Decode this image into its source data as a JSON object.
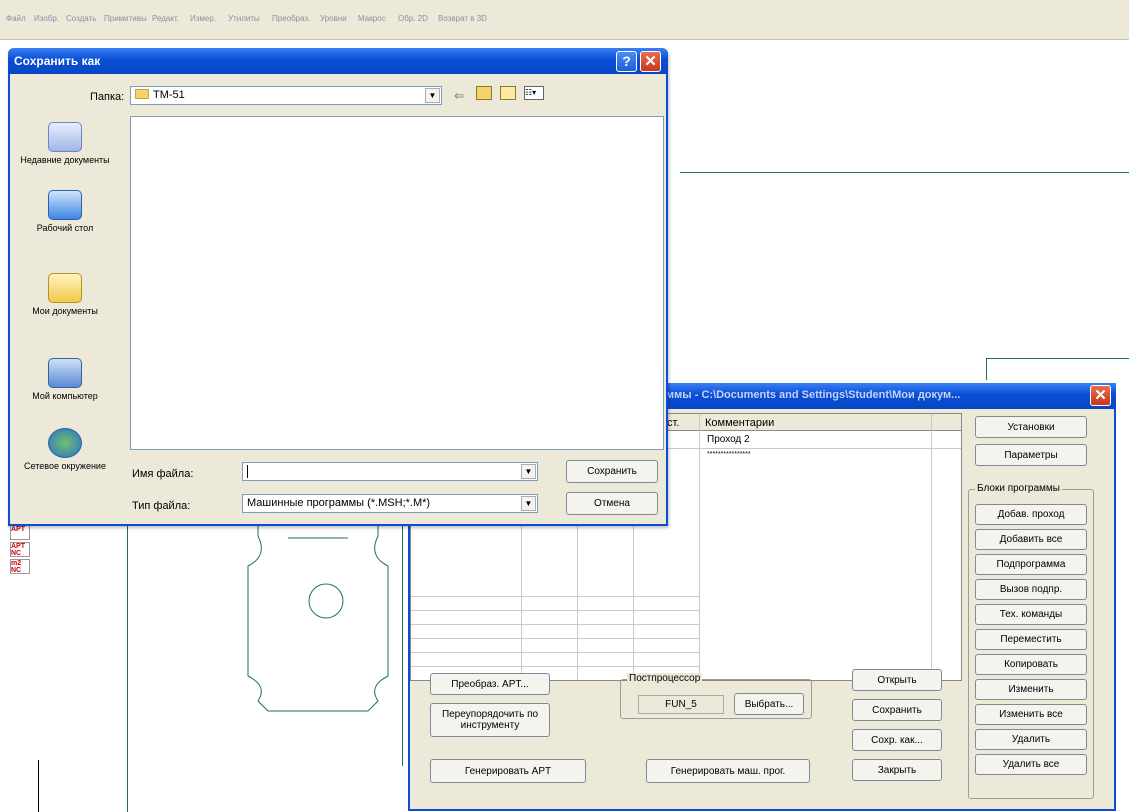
{
  "menubar": {
    "items": [
      "Файл",
      "Изобр.",
      "Создать",
      "Примитивы",
      "Редакт.",
      "Измер.",
      "Утилиты",
      "Преобраз.",
      "Уровни",
      "Макрос",
      "Обр. 2D",
      "Возврат в 3D"
    ]
  },
  "left_toolbar": {
    "items": [
      "APT",
      "APT NC",
      "m2 NC"
    ]
  },
  "save_dialog": {
    "title": "Сохранить как",
    "folder_label": "Папка:",
    "folder_value": "TM-51",
    "places": [
      "Недавние документы",
      "Рабочий стол",
      "Мои документы",
      "Мой компьютер",
      "Сетевое окружение"
    ],
    "filename_label": "Имя файла:",
    "filename_value": "",
    "filetype_label": "Тип файла:",
    "filetype_value": "Машинные программы (*.MSH;*.M*)",
    "save_button": "Сохранить",
    "cancel_button": "Отмена",
    "help_glyph": "?",
    "close_glyph": "✕"
  },
  "program_dialog": {
    "title": "ммы - C:\\Documents and Settings\\Student\\Мои докум...",
    "table": {
      "columns": [
        "ст.",
        "Комментарии"
      ],
      "rows": [
        [
          "",
          "Проход 2"
        ],
        [
          "",
          "****************"
        ]
      ]
    },
    "buttons": {
      "setup": "Установки",
      "params": "Параметры",
      "add_pass": "Добав. проход",
      "add_all": "Добавить все",
      "subprogram": "Подпрограмма",
      "call_sub": "Вызов подпр.",
      "tech_commands": "Тех. команды",
      "move": "Переместить",
      "copy": "Копировать",
      "change": "Изменить",
      "change_all": "Изменить все",
      "delete": "Удалить",
      "delete_all": "Удалить все",
      "convert_apt": "Преобраз. APT...",
      "reorder": "Переупорядочить по инструменту",
      "gen_apt": "Генерировать APT",
      "choose": "Выбрать...",
      "gen_machine": "Генерировать маш. прог.",
      "open": "Открыть",
      "save": "Сохранить",
      "save_as": "Сохр. как...",
      "close": "Закрыть"
    },
    "blocks_group_label": "Блоки программы",
    "postprocessor_label": "Постпроцессор",
    "postprocessor_value": "FUN_5",
    "close_glyph": "✕"
  },
  "colors": {
    "titlebar": "#0a4ed6",
    "dialog_bg": "#ece9d8",
    "close_red": "#d9472b",
    "drawing_line": "#1f6e6a"
  }
}
